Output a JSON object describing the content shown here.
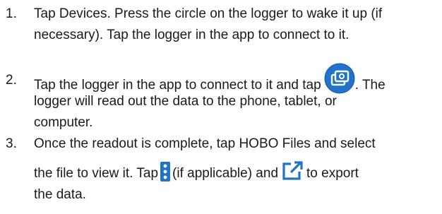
{
  "steps": [
    {
      "number": "1.",
      "lines": [
        "Tap Devices. Press the circle on the logger to wake it up (if",
        "necessary). Tap the logger in the app to connect to it."
      ]
    },
    {
      "number": "2.",
      "line1_before_icon": "Tap the logger in the app to connect to it and tap",
      "line1_after_icon": ". The",
      "lines_rest": [
        "logger will read out the data to the phone, tablet, or",
        "computer."
      ],
      "icon": "readout-icon"
    },
    {
      "number": "3.",
      "line1": "Once the readout is complete, tap HOBO Files and select",
      "line2_part1": "the file to view it. Tap",
      "line2_part2": "(if applicable) and",
      "line2_part3": "to export",
      "line3": "the data.",
      "icons": [
        "menu-icon",
        "export-icon"
      ]
    }
  ],
  "colors": {
    "icon_blue": "#1f73c8",
    "icon_dark_blue": "#185a9d",
    "text": "#1a1a1a"
  }
}
